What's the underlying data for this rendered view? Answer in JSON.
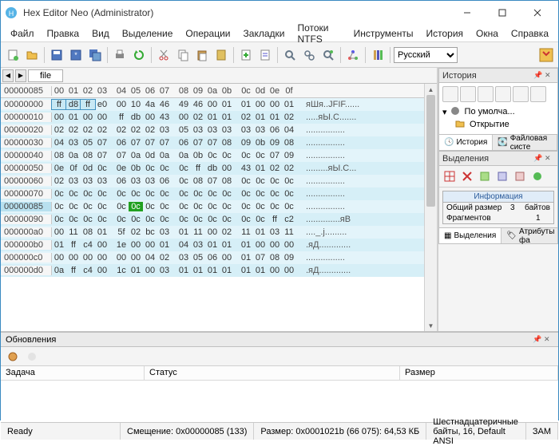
{
  "window": {
    "title": "Hex Editor Neo (Administrator)"
  },
  "menu": [
    "Файл",
    "Правка",
    "Вид",
    "Выделение",
    "Операции",
    "Закладки",
    "Потоки NTFS",
    "Инструменты",
    "История",
    "Окна",
    "Справка"
  ],
  "language": "Русский",
  "tab": {
    "name": "file"
  },
  "hex": {
    "addr_header": "00000085",
    "col_headers": [
      "00",
      "01",
      "02",
      "03",
      "04",
      "05",
      "06",
      "07",
      "08",
      "09",
      "0a",
      "0b",
      "0c",
      "0d",
      "0e",
      "0f"
    ],
    "rows": [
      {
        "addr": "00000000",
        "b": [
          "ff",
          "d8",
          "ff",
          "e0",
          "00",
          "10",
          "4a",
          "46",
          "49",
          "46",
          "00",
          "01",
          "01",
          "00",
          "00",
          "01"
        ],
        "a": "яШя..JFIF......",
        "sel": [
          0,
          1,
          2
        ]
      },
      {
        "addr": "00000010",
        "b": [
          "00",
          "01",
          "00",
          "00",
          "ff",
          "db",
          "00",
          "43",
          "00",
          "02",
          "01",
          "01",
          "02",
          "01",
          "01",
          "02"
        ],
        "a": ".....яЫ.C......."
      },
      {
        "addr": "00000020",
        "b": [
          "02",
          "02",
          "02",
          "02",
          "02",
          "02",
          "02",
          "03",
          "05",
          "03",
          "03",
          "03",
          "03",
          "03",
          "06",
          "04"
        ],
        "a": "................"
      },
      {
        "addr": "00000030",
        "b": [
          "04",
          "03",
          "05",
          "07",
          "06",
          "07",
          "07",
          "07",
          "06",
          "07",
          "07",
          "08",
          "09",
          "0b",
          "09",
          "08"
        ],
        "a": "................"
      },
      {
        "addr": "00000040",
        "b": [
          "08",
          "0a",
          "08",
          "07",
          "07",
          "0a",
          "0d",
          "0a",
          "0a",
          "0b",
          "0c",
          "0c",
          "0c",
          "0c",
          "07",
          "09"
        ],
        "a": "................"
      },
      {
        "addr": "00000050",
        "b": [
          "0e",
          "0f",
          "0d",
          "0c",
          "0e",
          "0b",
          "0c",
          "0c",
          "0c",
          "ff",
          "db",
          "00",
          "43",
          "01",
          "02",
          "02"
        ],
        "a": ".........яЫ.C..."
      },
      {
        "addr": "00000060",
        "b": [
          "02",
          "03",
          "03",
          "03",
          "06",
          "03",
          "03",
          "06",
          "0c",
          "08",
          "07",
          "08",
          "0c",
          "0c",
          "0c",
          "0c"
        ],
        "a": "................"
      },
      {
        "addr": "00000070",
        "b": [
          "0c",
          "0c",
          "0c",
          "0c",
          "0c",
          "0c",
          "0c",
          "0c",
          "0c",
          "0c",
          "0c",
          "0c",
          "0c",
          "0c",
          "0c",
          "0c"
        ],
        "a": "................"
      },
      {
        "addr": "00000085",
        "b": [
          "0c",
          "0c",
          "0c",
          "0c",
          "0c",
          "0c",
          "0c",
          "0c",
          "0c",
          "0c",
          "0c",
          "0c",
          "0c",
          "0c",
          "0c",
          "0c"
        ],
        "a": "................",
        "current": true,
        "curbyte": 5
      },
      {
        "addr": "00000090",
        "b": [
          "0c",
          "0c",
          "0c",
          "0c",
          "0c",
          "0c",
          "0c",
          "0c",
          "0c",
          "0c",
          "0c",
          "0c",
          "0c",
          "0c",
          "ff",
          "c2"
        ],
        "a": "..............яВ"
      },
      {
        "addr": "000000a0",
        "b": [
          "00",
          "11",
          "08",
          "01",
          "5f",
          "02",
          "bc",
          "03",
          "01",
          "11",
          "00",
          "02",
          "11",
          "01",
          "03",
          "11"
        ],
        "a": "...._.ј........."
      },
      {
        "addr": "000000b0",
        "b": [
          "01",
          "ff",
          "c4",
          "00",
          "1e",
          "00",
          "00",
          "01",
          "04",
          "03",
          "01",
          "01",
          "01",
          "00",
          "00",
          "00"
        ],
        "a": ".яД............."
      },
      {
        "addr": "000000c0",
        "b": [
          "00",
          "00",
          "00",
          "00",
          "00",
          "00",
          "04",
          "02",
          "03",
          "05",
          "06",
          "00",
          "01",
          "07",
          "08",
          "09"
        ],
        "a": "................"
      },
      {
        "addr": "000000d0",
        "b": [
          "0a",
          "ff",
          "c4",
          "00",
          "1c",
          "01",
          "00",
          "03",
          "01",
          "01",
          "01",
          "01",
          "01",
          "01",
          "00",
          "00"
        ],
        "a": ".яД............."
      }
    ]
  },
  "history": {
    "title": "История",
    "default": "По умолча...",
    "open": "Открытие",
    "tabs": [
      "История",
      "Файловая систе"
    ]
  },
  "selections": {
    "title": "Выделения",
    "info_title": "Информация",
    "rows": [
      {
        "k": "Общий размер",
        "v": "3",
        "u": "байтов"
      },
      {
        "k": "Фрагментов",
        "v": "1",
        "u": ""
      }
    ],
    "tabs": [
      "Выделения",
      "Атрибуты фа"
    ]
  },
  "updates": {
    "title": "Обновления",
    "cols": [
      "Задача",
      "Статус",
      "Размер"
    ]
  },
  "status": {
    "ready": "Ready",
    "offset": "Смещение: 0x00000085 (133)",
    "size": "Размер: 0x0001021b (66 075): 64,53 КБ",
    "mode": "Шестнадцатеричные байты, 16, Default ANSI",
    "ovr": "ЗАМ"
  }
}
